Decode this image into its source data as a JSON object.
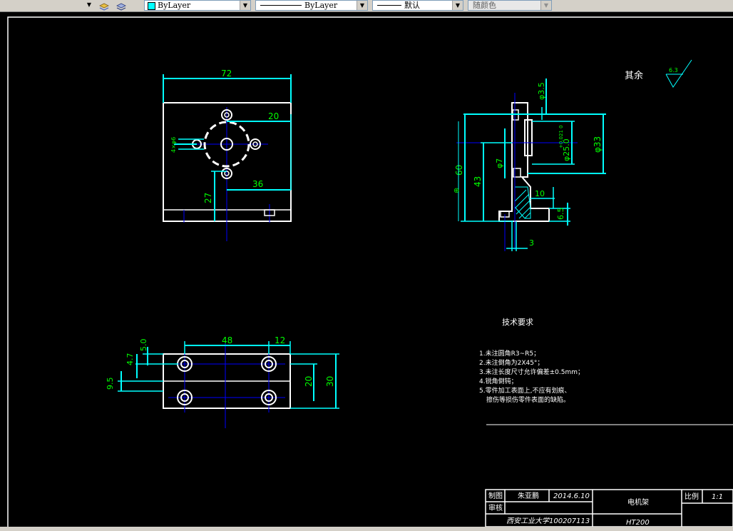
{
  "toolbar": {
    "layer_color_label": "ByLayer",
    "linetype_label": "ByLayer",
    "lineweight_label": "默认",
    "plotstyle_label": "随颜色",
    "layer_icon": "layer-stack-icon",
    "layer_icon2": "layer-previous-icon",
    "color_swatch": "#00ffff"
  },
  "drawing": {
    "colors": {
      "dim": "#00ffff",
      "object": "#ffffff",
      "center": "#0000ff",
      "text": "#00ff00"
    },
    "top_view": {
      "dim_width": "72",
      "dim_20": "20",
      "dim_36": "36",
      "dim_27": "27",
      "dim_hole": "4×φ6"
    },
    "front_view": {
      "dim_48": "48",
      "dim_12": "12",
      "dim_5": "5.0",
      "dim_47": "4.7",
      "dim_95": "9.5",
      "dim_20": "20",
      "dim_30": "30"
    },
    "side_view": {
      "dim_35": "φ3.5",
      "dim_25": "φ25.0",
      "dim_tol": "+0.021 0",
      "dim_33": "φ33",
      "dim_7": "φ7",
      "dim_60": "60",
      "dim_43": "43",
      "dim_10": "10",
      "dim_65": "6.5",
      "dim_3": "3",
      "dim_theta": "⊕"
    },
    "roughness": {
      "label": "其余",
      "value": "6.3"
    },
    "notes": {
      "title": "技术要求",
      "items": [
        "1.未注圆角R3~R5；",
        "2.未注倒角为2X45°；",
        "3.未注长度尺寸允许偏差±0.5mm；",
        "4.锐角倒钝；",
        "5.零件加工表面上,不应有划痕、",
        "擦伤等损伤零件表面的缺陷。"
      ]
    },
    "title_block": {
      "drawn_label": "制图",
      "drawn_name": "朱亚鹏",
      "date": "2014.6.10",
      "check_label": "审核",
      "part_name": "电机架",
      "scale_label": "比例",
      "scale_value": "1:1",
      "school": "西安工业大学100207113",
      "material": "HT200"
    }
  }
}
